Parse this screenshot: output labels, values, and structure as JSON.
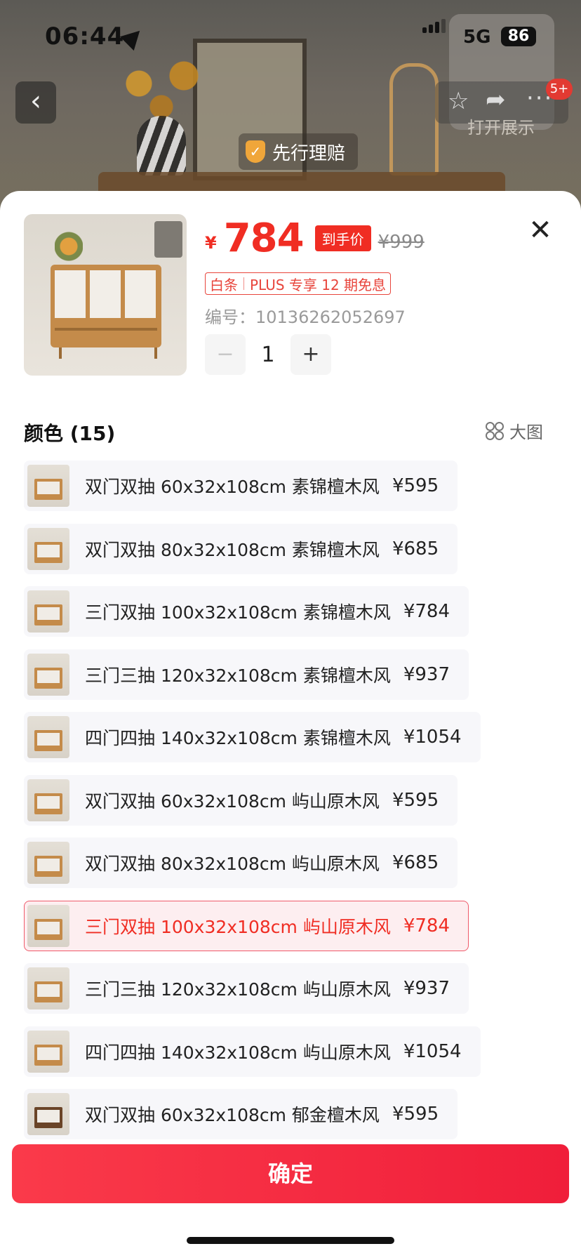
{
  "status_bar": {
    "time": "06:44",
    "network": "5G",
    "battery": "86"
  },
  "top": {
    "badge_count": "5+",
    "open_show": "打开展示",
    "claim_text": "先行理赔"
  },
  "product": {
    "currency": "¥",
    "price": "784",
    "price_tag": "到手价",
    "original_price": "¥999",
    "plus_left": "白条",
    "plus_right": "PLUS 专享 12 期免息",
    "sku_label": "编号：10136262052697",
    "quantity": "1",
    "minus_symbol": "−",
    "plus_symbol": "+"
  },
  "colors": {
    "header": "颜色 (15)",
    "big_pic": "大图",
    "items": [
      {
        "label": "双门双抽 60x32x108cm 素锦檀木风",
        "price": "¥595",
        "selected": false
      },
      {
        "label": "双门双抽 80x32x108cm 素锦檀木风",
        "price": "¥685",
        "selected": false
      },
      {
        "label": "三门双抽 100x32x108cm 素锦檀木风",
        "price": "¥784",
        "selected": false
      },
      {
        "label": "三门三抽 120x32x108cm 素锦檀木风",
        "price": "¥937",
        "selected": false
      },
      {
        "label": "四门四抽 140x32x108cm 素锦檀木风",
        "price": "¥1054",
        "selected": false
      },
      {
        "label": "双门双抽 60x32x108cm 屿山原木风",
        "price": "¥595",
        "selected": false
      },
      {
        "label": "双门双抽 80x32x108cm 屿山原木风",
        "price": "¥685",
        "selected": false
      },
      {
        "label": "三门双抽 100x32x108cm 屿山原木风",
        "price": "¥784",
        "selected": true
      },
      {
        "label": "三门三抽 120x32x108cm 屿山原木风",
        "price": "¥937",
        "selected": false
      },
      {
        "label": "四门四抽 140x32x108cm 屿山原木风",
        "price": "¥1054",
        "selected": false
      },
      {
        "label": "双门双抽 60x32x108cm 郁金檀木风",
        "price": "¥595",
        "selected": false
      }
    ]
  },
  "confirm_label": "确定",
  "accent_color": "#f02d23"
}
